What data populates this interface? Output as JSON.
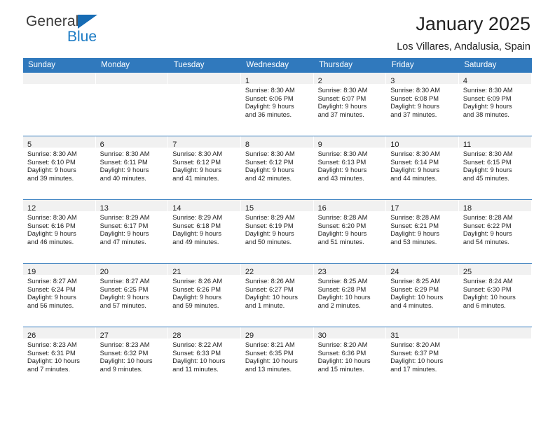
{
  "logo": {
    "text_top": "General",
    "text_bottom": "Blue",
    "triangle_color": "#176cb4",
    "top_color": "#3a3a3a",
    "bottom_color": "#1a7ac4"
  },
  "header": {
    "title": "January 2025",
    "subtitle": "Los Villares, Andalusia, Spain"
  },
  "theme": {
    "header_bg": "#3079bd",
    "header_text": "#ffffff",
    "daynum_bg": "#f1f1f1",
    "grid_line": "#3079bd",
    "body_text": "#222222"
  },
  "weekdays": [
    "Sunday",
    "Monday",
    "Tuesday",
    "Wednesday",
    "Thursday",
    "Friday",
    "Saturday"
  ],
  "weeks": [
    [
      {
        "day": "",
        "lines": []
      },
      {
        "day": "",
        "lines": []
      },
      {
        "day": "",
        "lines": []
      },
      {
        "day": "1",
        "lines": [
          "Sunrise: 8:30 AM",
          "Sunset: 6:06 PM",
          "Daylight: 9 hours",
          "and 36 minutes."
        ]
      },
      {
        "day": "2",
        "lines": [
          "Sunrise: 8:30 AM",
          "Sunset: 6:07 PM",
          "Daylight: 9 hours",
          "and 37 minutes."
        ]
      },
      {
        "day": "3",
        "lines": [
          "Sunrise: 8:30 AM",
          "Sunset: 6:08 PM",
          "Daylight: 9 hours",
          "and 37 minutes."
        ]
      },
      {
        "day": "4",
        "lines": [
          "Sunrise: 8:30 AM",
          "Sunset: 6:09 PM",
          "Daylight: 9 hours",
          "and 38 minutes."
        ]
      }
    ],
    [
      {
        "day": "5",
        "lines": [
          "Sunrise: 8:30 AM",
          "Sunset: 6:10 PM",
          "Daylight: 9 hours",
          "and 39 minutes."
        ]
      },
      {
        "day": "6",
        "lines": [
          "Sunrise: 8:30 AM",
          "Sunset: 6:11 PM",
          "Daylight: 9 hours",
          "and 40 minutes."
        ]
      },
      {
        "day": "7",
        "lines": [
          "Sunrise: 8:30 AM",
          "Sunset: 6:12 PM",
          "Daylight: 9 hours",
          "and 41 minutes."
        ]
      },
      {
        "day": "8",
        "lines": [
          "Sunrise: 8:30 AM",
          "Sunset: 6:12 PM",
          "Daylight: 9 hours",
          "and 42 minutes."
        ]
      },
      {
        "day": "9",
        "lines": [
          "Sunrise: 8:30 AM",
          "Sunset: 6:13 PM",
          "Daylight: 9 hours",
          "and 43 minutes."
        ]
      },
      {
        "day": "10",
        "lines": [
          "Sunrise: 8:30 AM",
          "Sunset: 6:14 PM",
          "Daylight: 9 hours",
          "and 44 minutes."
        ]
      },
      {
        "day": "11",
        "lines": [
          "Sunrise: 8:30 AM",
          "Sunset: 6:15 PM",
          "Daylight: 9 hours",
          "and 45 minutes."
        ]
      }
    ],
    [
      {
        "day": "12",
        "lines": [
          "Sunrise: 8:30 AM",
          "Sunset: 6:16 PM",
          "Daylight: 9 hours",
          "and 46 minutes."
        ]
      },
      {
        "day": "13",
        "lines": [
          "Sunrise: 8:29 AM",
          "Sunset: 6:17 PM",
          "Daylight: 9 hours",
          "and 47 minutes."
        ]
      },
      {
        "day": "14",
        "lines": [
          "Sunrise: 8:29 AM",
          "Sunset: 6:18 PM",
          "Daylight: 9 hours",
          "and 49 minutes."
        ]
      },
      {
        "day": "15",
        "lines": [
          "Sunrise: 8:29 AM",
          "Sunset: 6:19 PM",
          "Daylight: 9 hours",
          "and 50 minutes."
        ]
      },
      {
        "day": "16",
        "lines": [
          "Sunrise: 8:28 AM",
          "Sunset: 6:20 PM",
          "Daylight: 9 hours",
          "and 51 minutes."
        ]
      },
      {
        "day": "17",
        "lines": [
          "Sunrise: 8:28 AM",
          "Sunset: 6:21 PM",
          "Daylight: 9 hours",
          "and 53 minutes."
        ]
      },
      {
        "day": "18",
        "lines": [
          "Sunrise: 8:28 AM",
          "Sunset: 6:22 PM",
          "Daylight: 9 hours",
          "and 54 minutes."
        ]
      }
    ],
    [
      {
        "day": "19",
        "lines": [
          "Sunrise: 8:27 AM",
          "Sunset: 6:24 PM",
          "Daylight: 9 hours",
          "and 56 minutes."
        ]
      },
      {
        "day": "20",
        "lines": [
          "Sunrise: 8:27 AM",
          "Sunset: 6:25 PM",
          "Daylight: 9 hours",
          "and 57 minutes."
        ]
      },
      {
        "day": "21",
        "lines": [
          "Sunrise: 8:26 AM",
          "Sunset: 6:26 PM",
          "Daylight: 9 hours",
          "and 59 minutes."
        ]
      },
      {
        "day": "22",
        "lines": [
          "Sunrise: 8:26 AM",
          "Sunset: 6:27 PM",
          "Daylight: 10 hours",
          "and 1 minute."
        ]
      },
      {
        "day": "23",
        "lines": [
          "Sunrise: 8:25 AM",
          "Sunset: 6:28 PM",
          "Daylight: 10 hours",
          "and 2 minutes."
        ]
      },
      {
        "day": "24",
        "lines": [
          "Sunrise: 8:25 AM",
          "Sunset: 6:29 PM",
          "Daylight: 10 hours",
          "and 4 minutes."
        ]
      },
      {
        "day": "25",
        "lines": [
          "Sunrise: 8:24 AM",
          "Sunset: 6:30 PM",
          "Daylight: 10 hours",
          "and 6 minutes."
        ]
      }
    ],
    [
      {
        "day": "26",
        "lines": [
          "Sunrise: 8:23 AM",
          "Sunset: 6:31 PM",
          "Daylight: 10 hours",
          "and 7 minutes."
        ]
      },
      {
        "day": "27",
        "lines": [
          "Sunrise: 8:23 AM",
          "Sunset: 6:32 PM",
          "Daylight: 10 hours",
          "and 9 minutes."
        ]
      },
      {
        "day": "28",
        "lines": [
          "Sunrise: 8:22 AM",
          "Sunset: 6:33 PM",
          "Daylight: 10 hours",
          "and 11 minutes."
        ]
      },
      {
        "day": "29",
        "lines": [
          "Sunrise: 8:21 AM",
          "Sunset: 6:35 PM",
          "Daylight: 10 hours",
          "and 13 minutes."
        ]
      },
      {
        "day": "30",
        "lines": [
          "Sunrise: 8:20 AM",
          "Sunset: 6:36 PM",
          "Daylight: 10 hours",
          "and 15 minutes."
        ]
      },
      {
        "day": "31",
        "lines": [
          "Sunrise: 8:20 AM",
          "Sunset: 6:37 PM",
          "Daylight: 10 hours",
          "and 17 minutes."
        ]
      }
    ]
  ]
}
